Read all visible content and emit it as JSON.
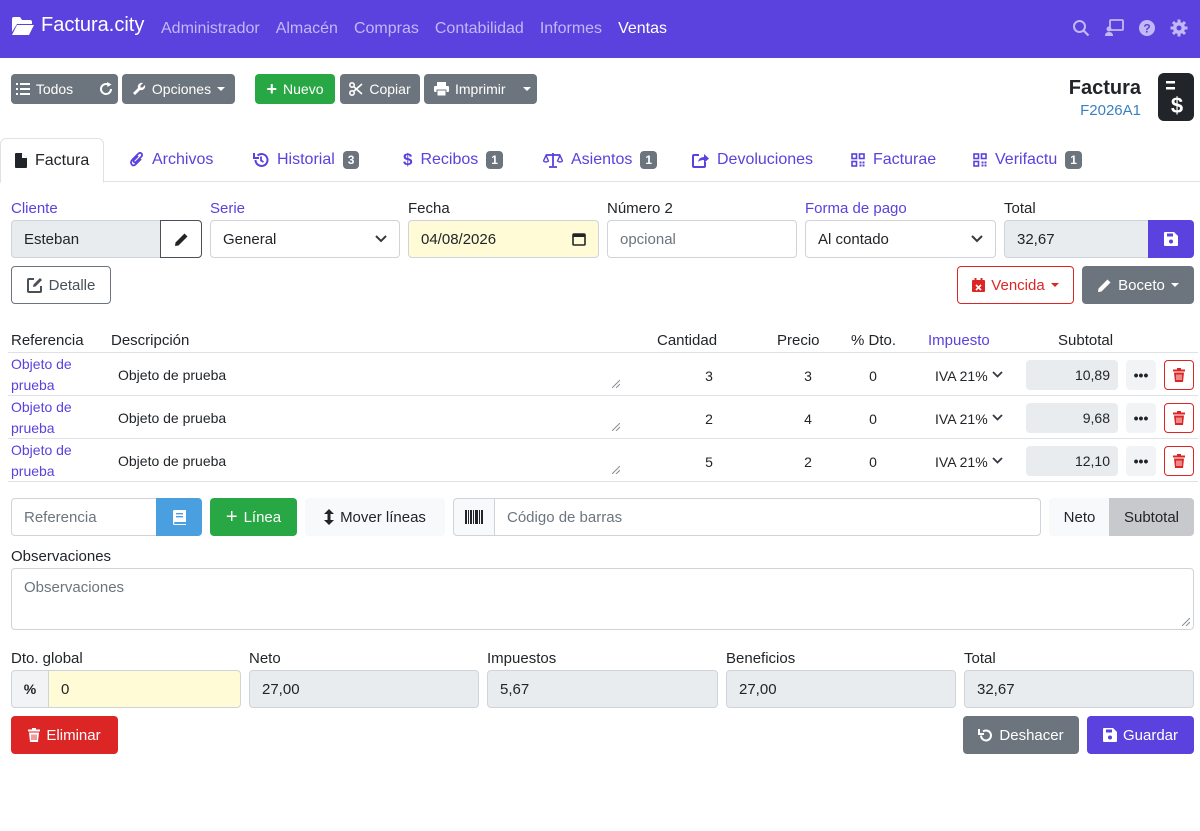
{
  "navbar": {
    "brand": "Factura.city",
    "links": [
      "Administrador",
      "Almacén",
      "Compras",
      "Contabilidad",
      "Informes",
      "Ventas"
    ],
    "active": "Ventas"
  },
  "toolbar": {
    "todos": "Todos",
    "opciones": "Opciones",
    "nuevo": "Nuevo",
    "copiar": "Copiar",
    "imprimir": "Imprimir"
  },
  "doc": {
    "title": "Factura",
    "code": "F2026A1"
  },
  "tabs": [
    {
      "label": "Factura",
      "badge": ""
    },
    {
      "label": "Archivos",
      "badge": ""
    },
    {
      "label": "Historial",
      "badge": "3"
    },
    {
      "label": "Recibos",
      "badge": "1"
    },
    {
      "label": "Asientos",
      "badge": "1"
    },
    {
      "label": "Devoluciones",
      "badge": ""
    },
    {
      "label": "Facturae",
      "badge": ""
    },
    {
      "label": "Verifactu",
      "badge": "1"
    }
  ],
  "form": {
    "cliente_label": "Cliente",
    "cliente_value": "Esteban",
    "serie_label": "Serie",
    "serie_value": "General",
    "fecha_label": "Fecha",
    "fecha_value": "04/08/2026",
    "numero2_label": "Número 2",
    "numero2_placeholder": "opcional",
    "pago_label": "Forma de pago",
    "pago_value": "Al contado",
    "total_label": "Total",
    "total_value": "32,67",
    "detalle": "Detalle",
    "vencida": "Vencida",
    "boceto": "Boceto"
  },
  "lines": {
    "headers": {
      "referencia": "Referencia",
      "descripcion": "Descripción",
      "cantidad": "Cantidad",
      "precio": "Precio",
      "dto": "% Dto.",
      "impuesto": "Impuesto",
      "subtotal": "Subtotal"
    },
    "rows": [
      {
        "ref": "Objeto de prueba",
        "desc": "Objeto de prueba",
        "cantidad": "3",
        "precio": "3",
        "dto": "0",
        "impuesto": "IVA 21%",
        "subtotal": "10,89"
      },
      {
        "ref": "Objeto de prueba",
        "desc": "Objeto de prueba",
        "cantidad": "2",
        "precio": "4",
        "dto": "0",
        "impuesto": "IVA 21%",
        "subtotal": "9,68"
      },
      {
        "ref": "Objeto de prueba",
        "desc": "Objeto de prueba",
        "cantidad": "5",
        "precio": "2",
        "dto": "0",
        "impuesto": "IVA 21%",
        "subtotal": "12,10"
      }
    ]
  },
  "addbar": {
    "ref_placeholder": "Referencia",
    "linea": "Línea",
    "mover": "Mover líneas",
    "barcode_placeholder": "Código de barras",
    "neto": "Neto",
    "subtotal": "Subtotal"
  },
  "observaciones": {
    "label": "Observaciones",
    "placeholder": "Observaciones"
  },
  "totals": {
    "dto_label": "Dto. global",
    "dto_value": "0",
    "neto_label": "Neto",
    "neto_value": "27,00",
    "impuestos_label": "Impuestos",
    "impuestos_value": "5,67",
    "beneficios_label": "Beneficios",
    "beneficios_value": "27,00",
    "total_label": "Total",
    "total_value": "32,67"
  },
  "actions": {
    "eliminar": "Eliminar",
    "deshacer": "Deshacer",
    "guardar": "Guardar"
  },
  "colors": {
    "primary": "#5b41dd",
    "success": "#28a745",
    "danger": "#dc2626",
    "secondary": "#6c757d",
    "info": "#4a9fe0"
  }
}
